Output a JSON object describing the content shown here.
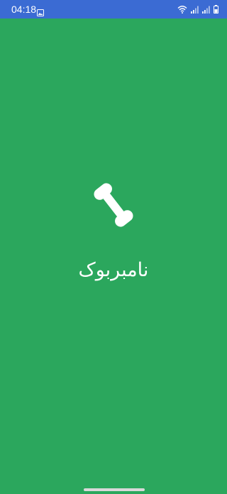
{
  "status_bar": {
    "time": "04:18",
    "icons": [
      "gallery-icon",
      "wifi-icon",
      "signal-icon",
      "signal-icon",
      "battery-icon"
    ],
    "background_color": "#3b6bd3"
  },
  "splash": {
    "background_color": "#2ba75d",
    "app_icon": "phone-handset-icon",
    "app_name": "نامبربوک"
  }
}
